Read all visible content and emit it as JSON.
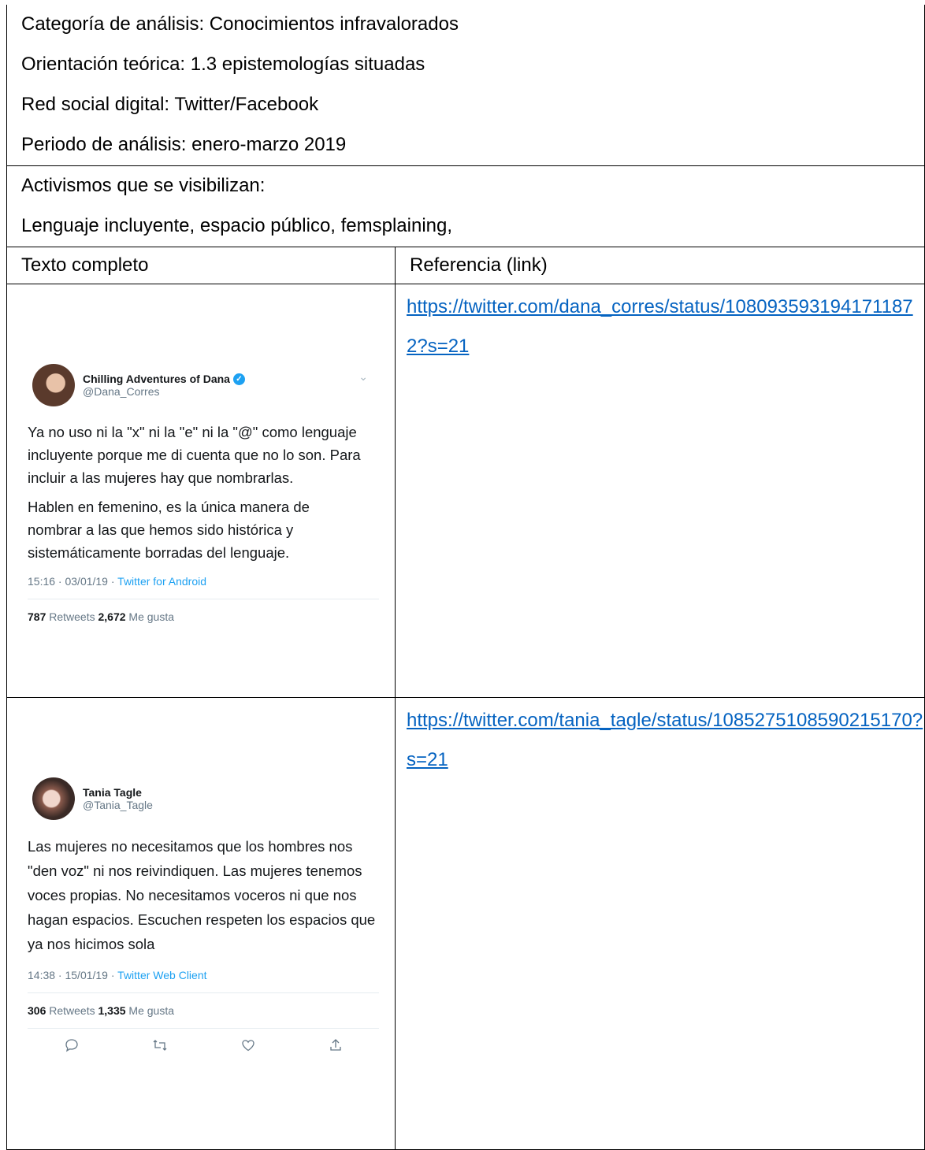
{
  "header": {
    "categoria": "Categoría de análisis: Conocimientos infravalorados",
    "orientacion": "Orientación teórica: 1.3 epistemologías situadas",
    "red_social": "Red social digital: Twitter/Facebook",
    "periodo": "Periodo de análisis:  enero-marzo 2019",
    "activismos_label": "Activismos que se visibilizan:",
    "activismos_value": "Lenguaje incluyente, espacio público, femsplaining,"
  },
  "table": {
    "col_texto": "Texto completo",
    "col_referencia": "Referencia (link)",
    "rows": [
      {
        "link": "https://twitter.com/dana_corres/status/1080935931941711872?s=21",
        "tweet": {
          "name": "Chilling Adventures of Dana",
          "handle": "@Dana_Corres",
          "paragraph_1": "Ya no uso ni la \"x\" ni la \"e\" ni la \"@\" como lenguaje incluyente porque me di cuenta que no lo son. Para incluir a las mujeres hay que nombrarlas.",
          "paragraph_2": "Hablen en femenino, es la única manera de nombrar a las que hemos sido histórica y sistemáticamente borradas del lenguaje.",
          "time": "15:16 · 03/01/19 · ",
          "source": "Twitter for Android",
          "retweets": "787",
          "retweets_label": " Retweets ",
          "likes": "2,672",
          "likes_label": " Me gusta"
        }
      },
      {
        "link": "https://twitter.com/tania_tagle/status/1085275108590215170?s=21",
        "tweet": {
          "name": "Tania Tagle",
          "handle": "@Tania_Tagle",
          "paragraph_1": "Las mujeres no necesitamos que los hombres nos \"den voz\" ni nos reivindiquen. Las mujeres tenemos voces propias. No necesitamos voceros ni que nos hagan espacios. Escuchen respeten los espacios que ya nos hicimos sola",
          "time": "14:38 · 15/01/19 · ",
          "source": "Twitter Web Client",
          "retweets": "306",
          "retweets_label": " Retweets ",
          "likes": "1,335",
          "likes_label": " Me gusta"
        }
      }
    ]
  },
  "icons": [
    "reply-icon",
    "retweet-icon",
    "like-icon",
    "share-icon"
  ],
  "colors": {
    "link": "#0563c1",
    "twitter_blue": "#1da1f2",
    "muted": "#657786"
  }
}
